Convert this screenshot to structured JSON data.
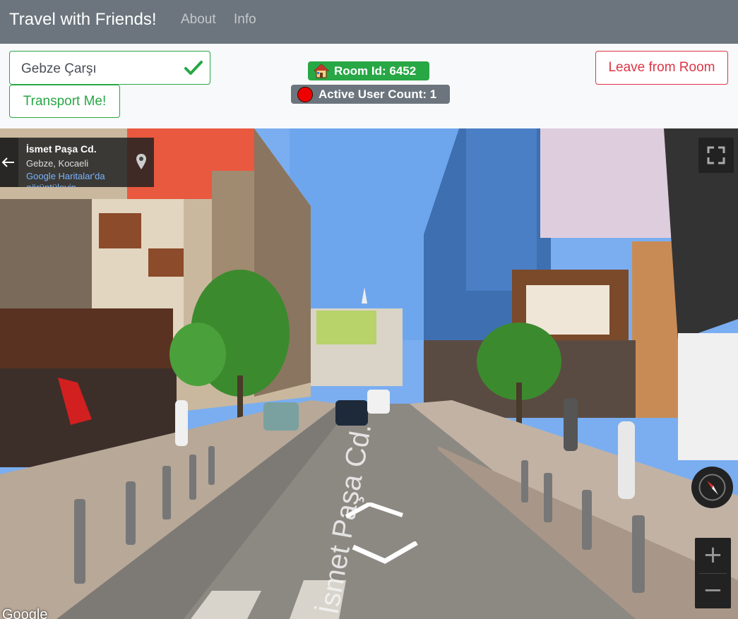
{
  "navbar": {
    "brand": "Travel with Friends!",
    "links": [
      "About",
      "Info"
    ]
  },
  "controls": {
    "location_value": "Gebze Çarşı",
    "transport_label": "Transport Me!",
    "leave_label": "Leave from Room"
  },
  "room": {
    "room_id_label": "Room Id: 6452",
    "active_users_label": "Active User Count: 1"
  },
  "streetview": {
    "street_name": "İsmet Paşa Cd.",
    "area": "Gebze, Kocaeli",
    "maps_link": "Google Haritalar'da görüntüleyin",
    "google_logo": "Google",
    "zoom_in": "+",
    "zoom_out": "−"
  },
  "colors": {
    "navbar": "#6c757d",
    "success": "#28a745",
    "danger": "#dc3545",
    "secondary": "#6c757d"
  },
  "icons": [
    "check-icon",
    "house-icon",
    "red-dot-icon",
    "back-arrow-icon",
    "pin-icon",
    "fullscreen-icon",
    "compass-icon"
  ]
}
